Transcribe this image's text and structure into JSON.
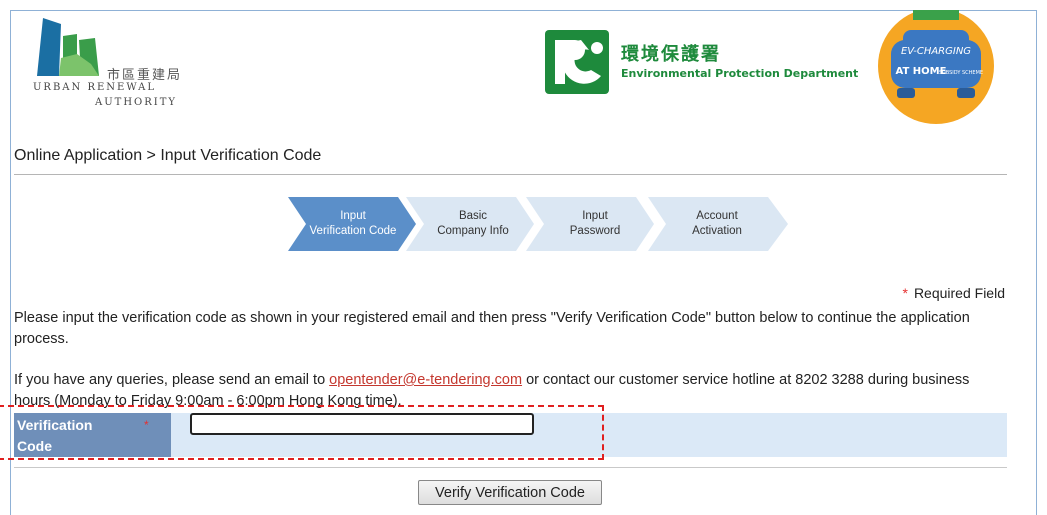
{
  "logos": {
    "ura_zh": "市區重建局",
    "ura_en_line1": "URBAN RENEWAL",
    "ura_en_line2": "AUTHORITY",
    "epd_zh": "環境保護署",
    "epd_en": "Environmental Protection Department",
    "ev_line1": "EV-CHARGING",
    "ev_line2": "AT HOME",
    "ev_line3": "SUBSIDY SCHEME"
  },
  "breadcrumb": "Online Application > Input Verification Code",
  "steps": [
    {
      "line1": "Input",
      "line2": "Verification Code",
      "active": true
    },
    {
      "line1": "Basic",
      "line2": "Company Info",
      "active": false
    },
    {
      "line1": "Input",
      "line2": "Password",
      "active": false
    },
    {
      "line1": "Account",
      "line2": "Activation",
      "active": false
    }
  ],
  "required_field": "Required Field",
  "required_star": "*",
  "instruction": "Please input the verification code as shown in your registered email and then press \"Verify Verification Code\" button below to continue the application process.",
  "queries": {
    "prefix": "If you have any queries, please send an email to ",
    "email": "opentender@e-tendering.com",
    "suffix": " or contact our customer service hotline at 8202 3288 during business hours (Monday to Friday 9:00am - 6:00pm Hong Kong time)."
  },
  "form": {
    "label": "Verification Code",
    "value": ""
  },
  "verify_button": "Verify Verification Code",
  "colors": {
    "step_active": "#5b8fc9",
    "step_inactive": "#dbe7f3",
    "label_bg": "#6f8fb9",
    "row_bg": "#dbe9f7",
    "epd_green": "#1e8a3c",
    "highlight": "#e02020"
  }
}
